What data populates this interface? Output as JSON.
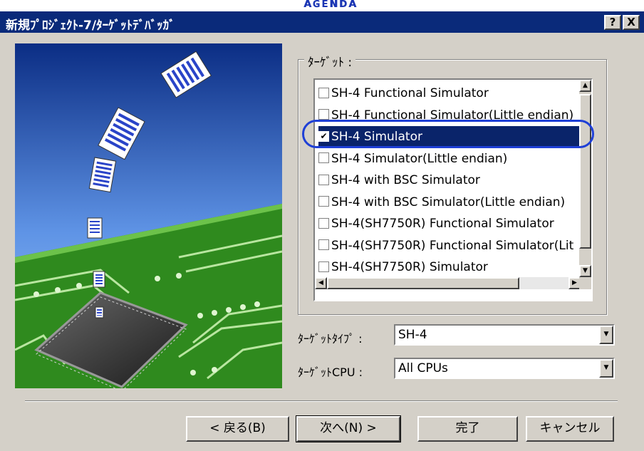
{
  "top_strip_text": "ᴀɢᴇɴᴅᴀ",
  "window": {
    "title": "新規ﾌﾟﾛｼﾞｪｸﾄ-7/ﾀｰｹﾞｯﾄﾃﾞﾊﾞｯｶﾞ",
    "help_btn": "?",
    "close_btn": "X"
  },
  "target_group": {
    "label": "ﾀｰｹﾞｯﾄ :",
    "items": [
      {
        "label": "SH-4 Functional Simulator",
        "checked": false
      },
      {
        "label": "SH-4 Functional Simulator(Little endian)",
        "checked": false
      },
      {
        "label": "SH-4 Simulator",
        "checked": true
      },
      {
        "label": "SH-4 Simulator(Little endian)",
        "checked": false
      },
      {
        "label": "SH-4 with BSC Simulator",
        "checked": false
      },
      {
        "label": "SH-4 with BSC Simulator(Little endian)",
        "checked": false
      },
      {
        "label": "SH-4(SH7750R) Functional Simulator",
        "checked": false
      },
      {
        "label": "SH-4(SH7750R) Functional Simulator(Lit",
        "checked": false
      },
      {
        "label": "SH-4(SH7750R) Simulator",
        "checked": false
      }
    ]
  },
  "target_type": {
    "label": "ﾀｰｹﾞｯﾄﾀｲﾌﾟ :",
    "value": "SH-4"
  },
  "target_cpu": {
    "label": "ﾀｰｹﾞｯﾄCPU :",
    "value": "All CPUs"
  },
  "buttons": {
    "back": "< 戻る(B)",
    "next": "次へ(N) >",
    "finish": "完了",
    "cancel": "キャンセル"
  },
  "check_mark": "✔",
  "colors": {
    "titlebar": "#0a2a7a",
    "selection": "#0a246a",
    "ring": "#1e3fd6",
    "board": "#2f8a1e"
  }
}
